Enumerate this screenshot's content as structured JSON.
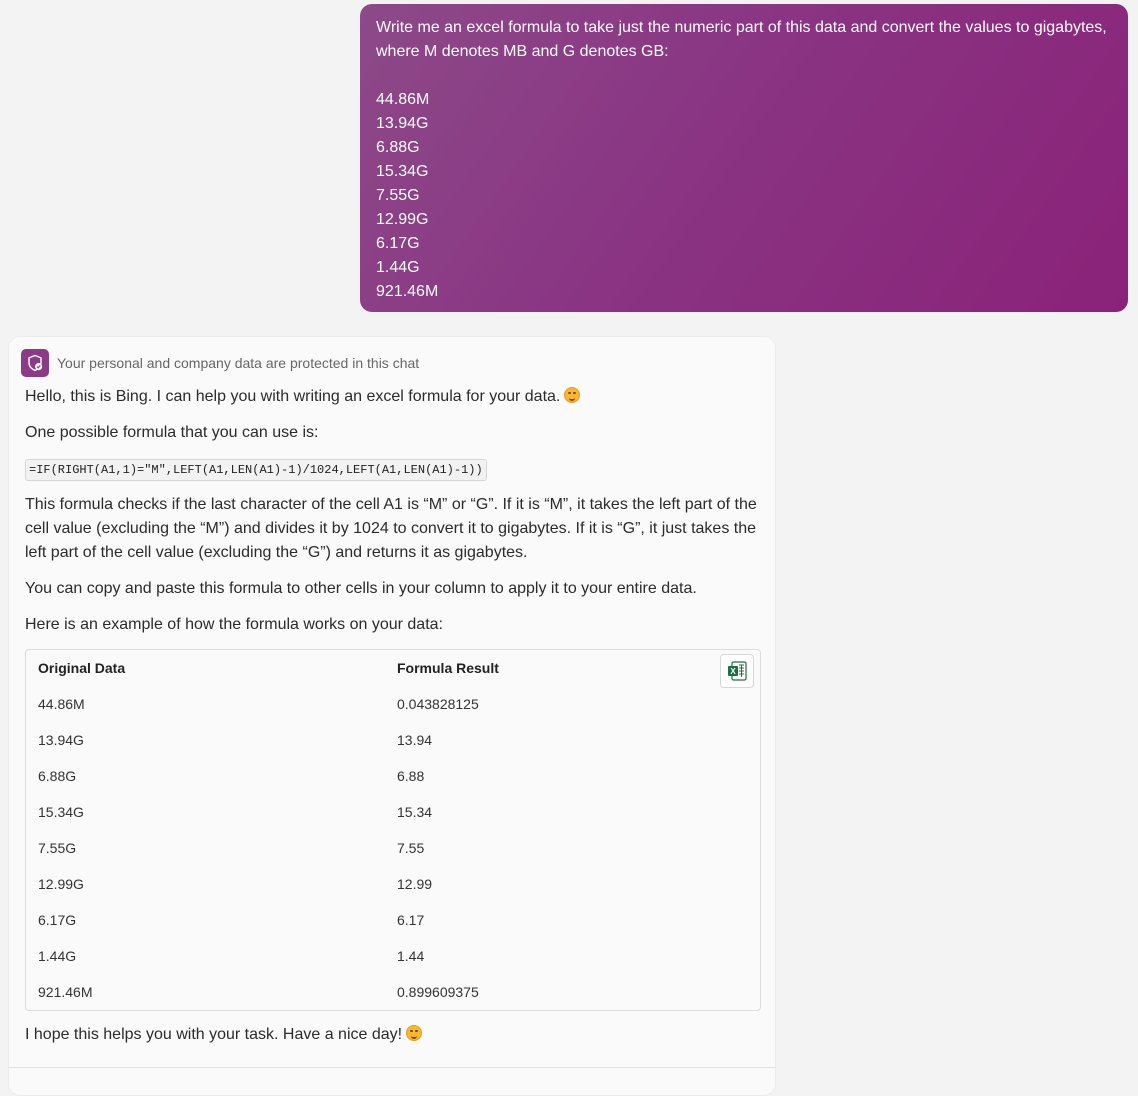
{
  "user_message": {
    "intro": "Write me an excel formula to take just the numeric part of this data and convert the values to gigabytes, where M denotes MB and G denotes GB:",
    "values": [
      "44.86M",
      "13.94G",
      "6.88G",
      "15.34G",
      "7.55G",
      "12.99G",
      "6.17G",
      "1.44G",
      "921.46M"
    ]
  },
  "bot": {
    "privacy_notice": "Your personal and company data are protected in this chat",
    "greeting": "Hello, this is Bing. I can help you with writing an excel formula for your data.",
    "lead": "One possible formula that you can use is:",
    "formula": "=IF(RIGHT(A1,1)=\"M\",LEFT(A1,LEN(A1)-1)/1024,LEFT(A1,LEN(A1)-1))",
    "explanation": "This formula checks if the last character of the cell A1 is “M” or “G”. If it is “M”, it takes the left part of the cell value (excluding the “M”) and divides it by 1024 to convert it to gigabytes. If it is “G”, it just takes the left part of the cell value (excluding the “G”) and returns it as gigabytes.",
    "copy_tip": "You can copy and paste this formula to other cells in your column to apply it to your entire data.",
    "example_intro": "Here is an example of how the formula works on your data:",
    "table": {
      "headers": [
        "Original Data",
        "Formula Result"
      ],
      "rows": [
        [
          "44.86M",
          "0.043828125"
        ],
        [
          "13.94G",
          "13.94"
        ],
        [
          "6.88G",
          "6.88"
        ],
        [
          "15.34G",
          "15.34"
        ],
        [
          "7.55G",
          "7.55"
        ],
        [
          "12.99G",
          "12.99"
        ],
        [
          "6.17G",
          "6.17"
        ],
        [
          "1.44G",
          "1.44"
        ],
        [
          "921.46M",
          "0.899609375"
        ]
      ]
    },
    "closing": "I hope this helps you with your task. Have a nice day!",
    "excel_icon_letter": "X"
  },
  "colors": {
    "user_bubble": "#8a2f80",
    "page_bg": "#f3f3f3",
    "excel_green": "#1d7044"
  }
}
